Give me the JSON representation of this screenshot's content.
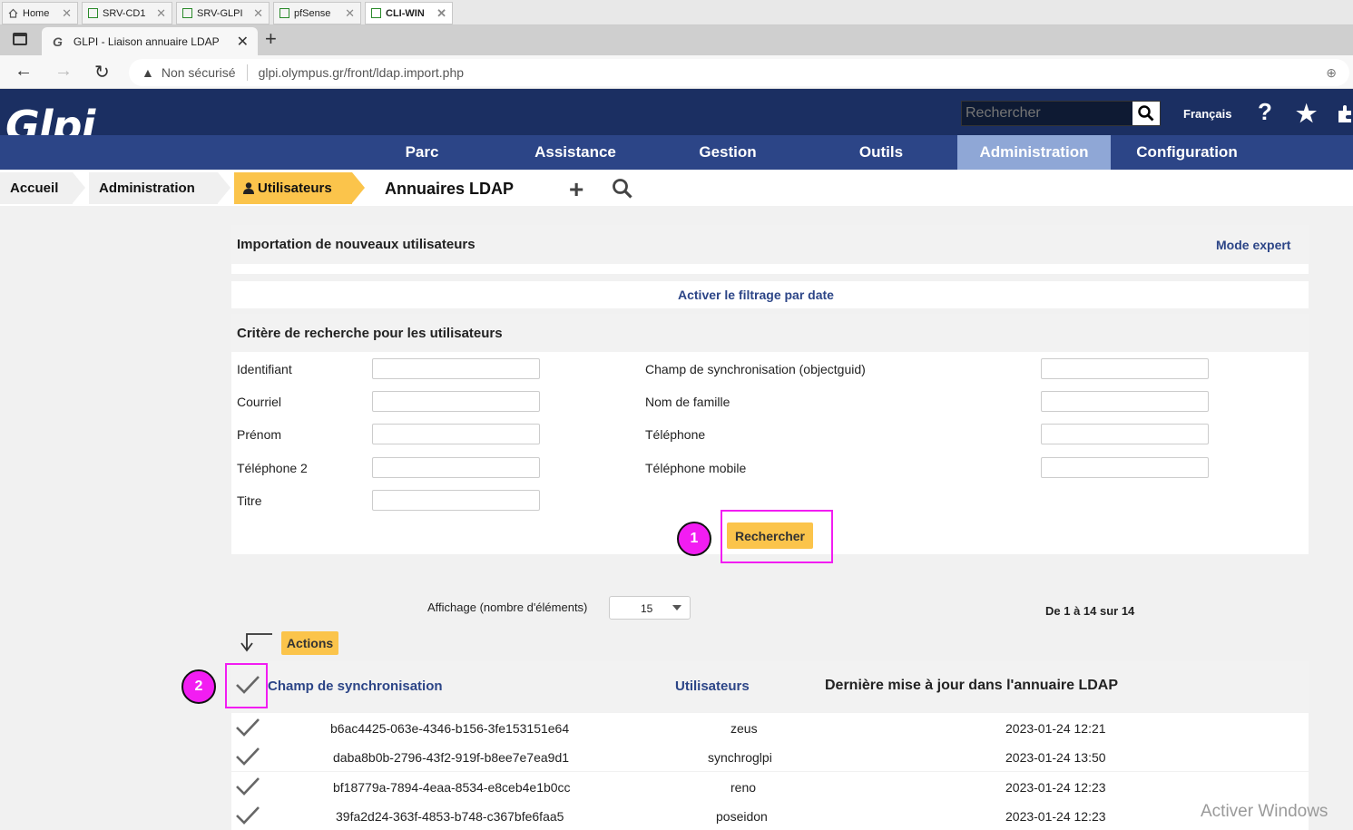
{
  "vm_tabs": [
    {
      "label": "Home"
    },
    {
      "label": "SRV-CD1"
    },
    {
      "label": "SRV-GLPI"
    },
    {
      "label": "pfSense"
    },
    {
      "label": "CLI-WIN"
    }
  ],
  "browser": {
    "tab_title": "GLPI - Liaison annuaire LDAP",
    "tab_glyph": "G",
    "new_tab": "+",
    "security_label": "Non sécurisé",
    "url": "glpi.olympus.gr/front/ldap.import.php"
  },
  "header": {
    "logo": "Glpi",
    "search_placeholder": "Rechercher",
    "language": "Français",
    "help": "?"
  },
  "menu": [
    "Parc",
    "Assistance",
    "Gestion",
    "Outils",
    "Administration",
    "Configuration"
  ],
  "breadcrumb": {
    "items": [
      "Accueil",
      "Administration",
      "Utilisateurs"
    ],
    "page_title": "Annuaires LDAP"
  },
  "import_section": {
    "title": "Importation de nouveaux utilisateurs",
    "expert_link": "Mode expert",
    "date_filter_link": "Activer le filtrage par date"
  },
  "criteria": {
    "title": "Critère de recherche pour les utilisateurs",
    "left_fields": [
      "Identifiant",
      "Courriel",
      "Prénom",
      "Téléphone 2",
      "Titre"
    ],
    "right_fields": [
      "Champ de synchronisation (objectguid)",
      "Nom de famille",
      "Téléphone",
      "Téléphone mobile"
    ],
    "search_button": "Rechercher"
  },
  "markers": [
    "1",
    "2"
  ],
  "pagination": {
    "display_label": "Affichage (nombre d'éléments)",
    "per_page": "15",
    "range": "De 1 à 14 sur 14"
  },
  "actions_button": "Actions",
  "table": {
    "headers": [
      "Champ de synchronisation",
      "Utilisateurs",
      "Dernière mise à jour dans l'annuaire LDAP"
    ],
    "rows": [
      {
        "sync": "b6ac4425-063e-4346-b156-3fe153151e64",
        "user": "zeus",
        "date": "2023-01-24 12:21"
      },
      {
        "sync": "daba8b0b-2796-43f2-919f-b8ee7e7ea9d1",
        "user": "synchroglpi",
        "date": "2023-01-24 13:50"
      },
      {
        "sync": "bf18779a-7894-4eaa-8534-e8ceb4e1b0cc",
        "user": "reno",
        "date": "2023-01-24 12:23"
      },
      {
        "sync": "39fa2d24-363f-4853-b748-c367bfe6faa5",
        "user": "poseidon",
        "date": "2023-01-24 12:23"
      }
    ]
  },
  "watermark": "Activer Windows"
}
